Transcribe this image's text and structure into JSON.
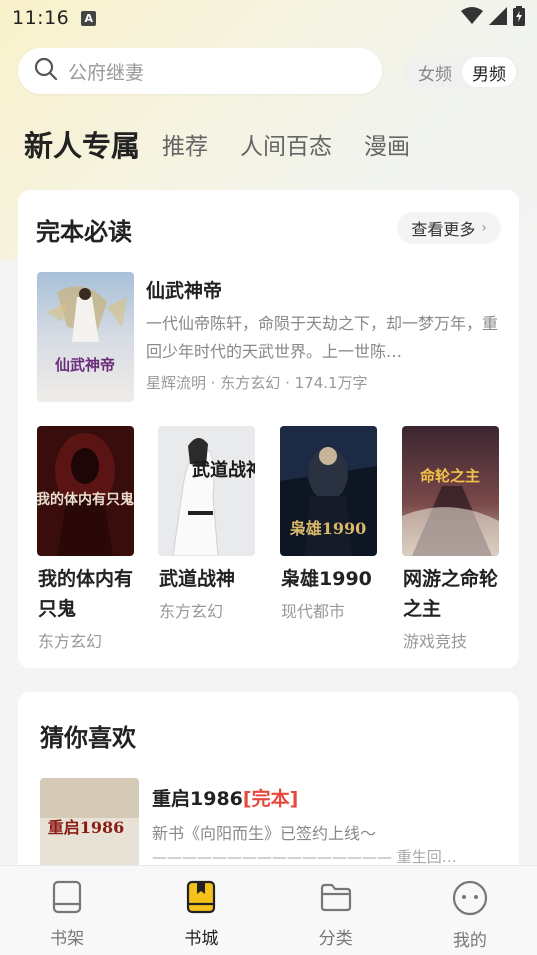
{
  "status": {
    "time": "11:16",
    "notif_letter": "A"
  },
  "search": {
    "placeholder": "公府继妻"
  },
  "freq_toggle": {
    "female": "女频",
    "male": "男频"
  },
  "tabs": [
    "新人专属",
    "推荐",
    "人间百态",
    "漫画"
  ],
  "section_complete": {
    "title": "完本必读",
    "more_label": "查看更多",
    "featured": {
      "title": "仙武神帝",
      "desc": "一代仙帝陈轩，命陨于天劫之下，却一梦万年，重回少年时代的天武世界。上一世陈…",
      "meta": "星辉流明 · 东方玄幻 · 174.1万字",
      "cover_text": "仙武神帝"
    },
    "books": [
      {
        "name": "我的体内有只鬼",
        "category": "东方玄幻",
        "cover_text": "我的体内有只鬼"
      },
      {
        "name": "武道战神",
        "category": "东方玄幻",
        "cover_text": "武道战神"
      },
      {
        "name": "枭雄1990",
        "category": "现代都市",
        "cover_text": "枭雄1990"
      },
      {
        "name": "网游之命轮之主",
        "category": "游戏竞技",
        "cover_text": "命轮之主"
      }
    ]
  },
  "section_guess": {
    "title": "猜你喜欢",
    "item": {
      "title": "重启1986",
      "tag": "[完本]",
      "desc": "新书《向阳而生》已签约上线～",
      "sub": "———————————————— 重生回…",
      "cover_text": "重启1986"
    }
  },
  "nav": [
    {
      "label": "书架",
      "icon": "bookshelf-icon"
    },
    {
      "label": "书城",
      "icon": "bookstore-icon",
      "active": true
    },
    {
      "label": "分类",
      "icon": "folder-icon"
    },
    {
      "label": "我的",
      "icon": "profile-icon"
    }
  ],
  "colors": {
    "accent": "#f4c21b",
    "tag_red": "#e8473e"
  }
}
